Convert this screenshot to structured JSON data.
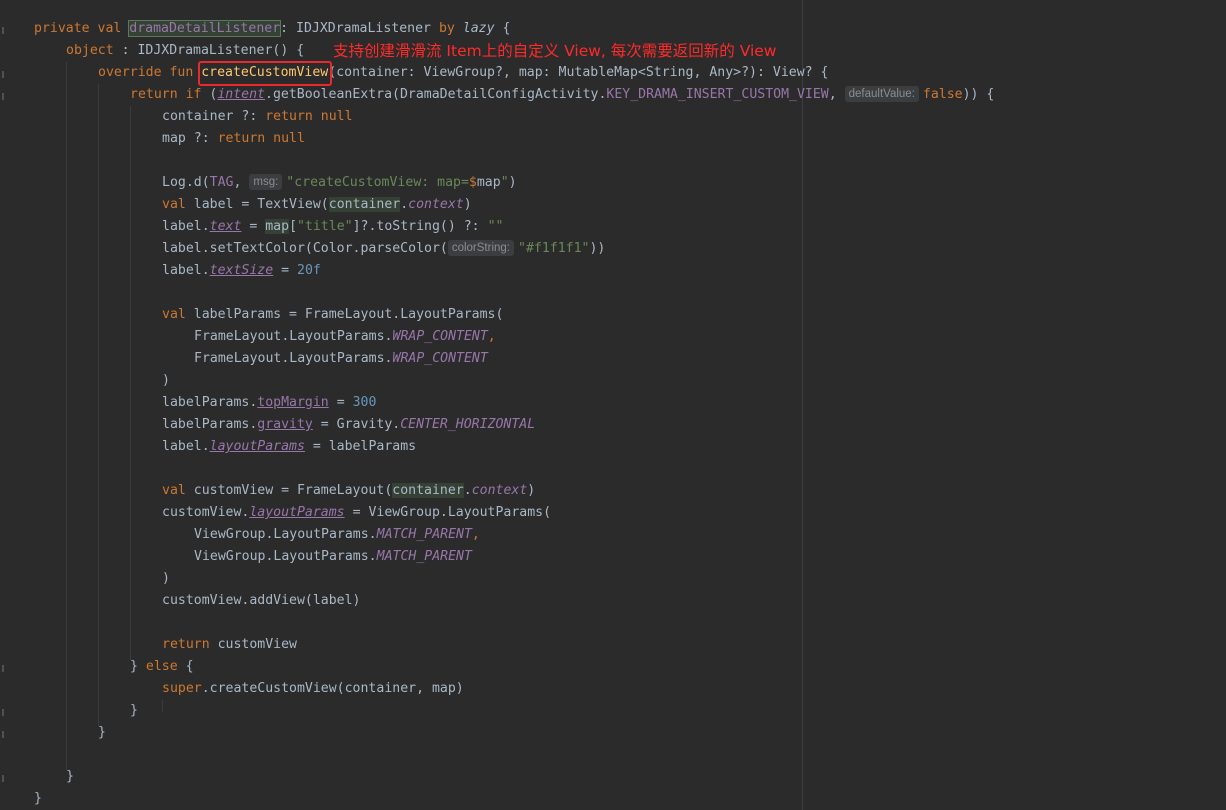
{
  "annotation": {
    "text": "支持创建滑滑流 Item上的自定义 View, 每次需要返回新的 View",
    "color": "#ff2a2a"
  },
  "hints": {
    "default_value": "defaultValue:",
    "msg": "msg:",
    "color_string": "colorString:"
  },
  "code": {
    "l1": {
      "k1": "private val ",
      "name": "dramaDetailListener",
      "t1": ": IDJXDramaListener ",
      "by": "by ",
      "lazy": "lazy",
      "t2": " {"
    },
    "l2": {
      "k1": "object",
      "t1": " : IDJXDramaListener() {"
    },
    "l3": {
      "k1": "override fun ",
      "fn": "createCustomView",
      "t1": "(container: ViewGroup?, map: MutableMap<String, Any>?): View? {"
    },
    "l4": {
      "k1": "return if ",
      "t1": "(",
      "intent": "intent",
      "t2": ".getBooleanExtra(DramaDetailConfigActivity.",
      "key": "KEY_DRAMA_INSERT_CUSTOM_VIEW",
      "t3": ", ",
      "val": "false",
      "t4": ")) {"
    },
    "l5": {
      "t1": "container ?: ",
      "k1": "return null"
    },
    "l6": {
      "t1": "map ?: ",
      "k1": "return null"
    },
    "l7": {
      "t1": "Log.d(",
      "tag": "TAG",
      "t2": ", ",
      "s1": "\"createCustomView: map=",
      "dollar": "$",
      "t3": "map",
      "s2": "\"",
      "t4": ")"
    },
    "l8": {
      "k1": "val ",
      "t1": "label = TextView(",
      "ctn": "container",
      "t2": ".",
      "ctx": "context",
      "t3": ")"
    },
    "l9": {
      "t1": "label.",
      "prop": "text",
      "t2": " = ",
      "map": "map",
      "t3": "[",
      "s1": "\"title\"",
      "t4": "]?.toString() ?: ",
      "s2": "\"\""
    },
    "l10": {
      "t1": "label.setTextColor(Color.parseColor(",
      "s1": "\"#f1f1f1\"",
      "t2": "))"
    },
    "l11": {
      "t1": "label.",
      "prop": "textSize",
      "t2": " = ",
      "num": "20f"
    },
    "l12": {
      "k1": "val ",
      "t1": "labelParams = FrameLayout.LayoutParams("
    },
    "l13": {
      "t1": "FrameLayout.LayoutParams.",
      "c1": "WRAP_CONTENT",
      "k1": ","
    },
    "l14": {
      "t1": "FrameLayout.LayoutParams.",
      "c1": "WRAP_CONTENT"
    },
    "l15": {
      "t1": ")"
    },
    "l16": {
      "t1": "labelParams.",
      "prop": "topMargin",
      "t2": " = ",
      "num": "300"
    },
    "l17": {
      "t1": "labelParams.",
      "prop": "gravity",
      "t2": " = Gravity.",
      "c1": "CENTER_HORIZONTAL"
    },
    "l18": {
      "t1": "label.",
      "prop": "layoutParams",
      "t2": " = labelParams"
    },
    "l19": {
      "k1": "val ",
      "t1": "customView = FrameLayout(",
      "ctn": "container",
      "t2": ".",
      "ctx": "context",
      "t3": ")"
    },
    "l20": {
      "t1": "customView.",
      "prop": "layoutParams",
      "t2": " = ViewGroup.LayoutParams("
    },
    "l21": {
      "t1": "ViewGroup.LayoutParams.",
      "c1": "MATCH_PARENT",
      "k1": ","
    },
    "l22": {
      "t1": "ViewGroup.LayoutParams.",
      "c1": "MATCH_PARENT"
    },
    "l23": {
      "t1": ")"
    },
    "l24": {
      "t1": "customView.addView(label)"
    },
    "l25": {
      "k1": "return ",
      "t1": "customView"
    },
    "l26": {
      "t1": "} ",
      "k1": "else",
      "t2": " {"
    },
    "l27": {
      "k1": "super",
      "t1": ".createCustomView(container, map)"
    },
    "l28": {
      "t1": "}"
    },
    "l29": {
      "t1": "}"
    },
    "l30": {
      "t1": "}"
    },
    "l31": {
      "t1": "}"
    }
  }
}
